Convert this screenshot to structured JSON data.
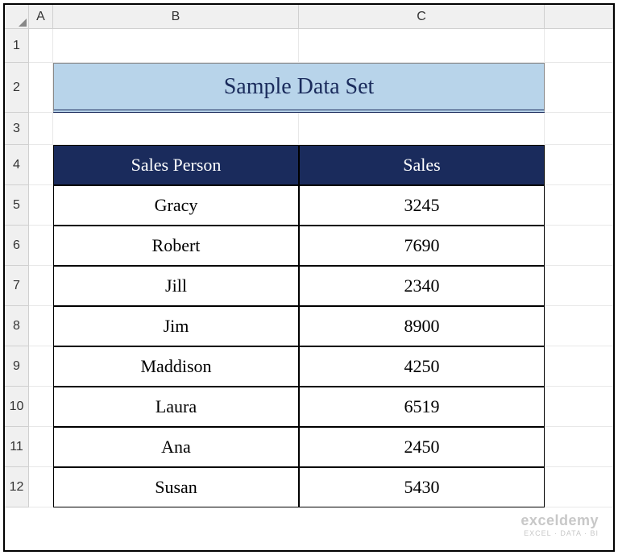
{
  "columns": [
    "",
    "A",
    "B",
    "C",
    ""
  ],
  "rows": [
    "1",
    "2",
    "3",
    "4",
    "5",
    "6",
    "7",
    "8",
    "9",
    "10",
    "11",
    "12"
  ],
  "title": "Sample Data Set",
  "table": {
    "headers": [
      "Sales Person",
      "Sales"
    ],
    "data": [
      {
        "person": "Gracy",
        "sales": "3245"
      },
      {
        "person": "Robert",
        "sales": "7690"
      },
      {
        "person": "Jill",
        "sales": "2340"
      },
      {
        "person": "Jim",
        "sales": "8900"
      },
      {
        "person": "Maddison",
        "sales": "4250"
      },
      {
        "person": "Laura",
        "sales": "6519"
      },
      {
        "person": "Ana",
        "sales": "2450"
      },
      {
        "person": "Susan",
        "sales": "5430"
      }
    ]
  },
  "watermark": {
    "brand": "exceldemy",
    "tag": "EXCEL · DATA · BI"
  }
}
